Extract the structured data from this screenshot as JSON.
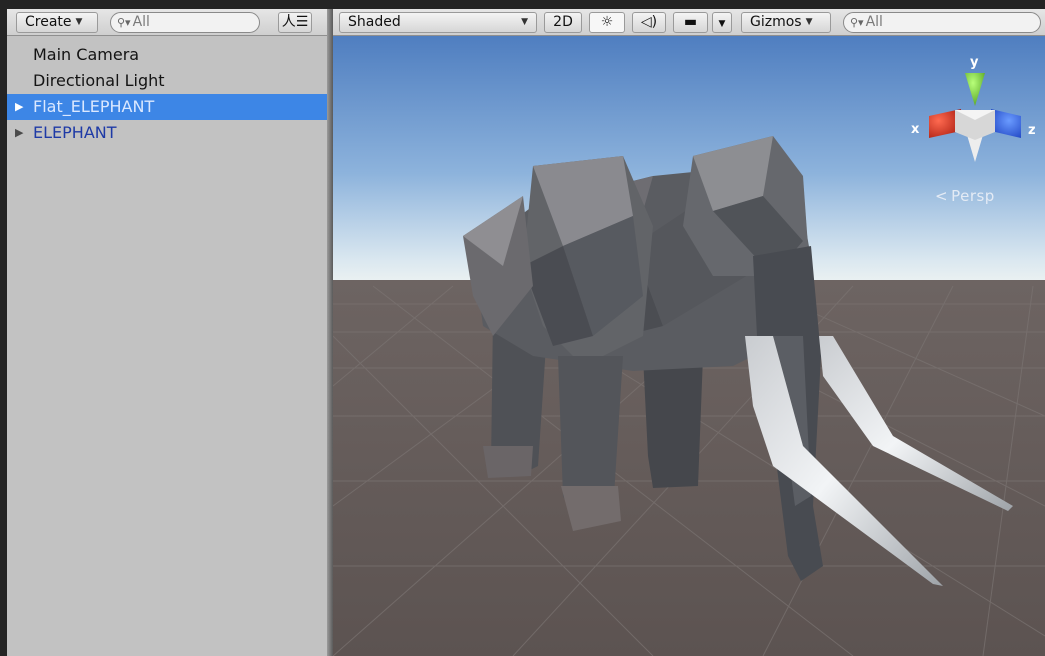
{
  "hierarchy": {
    "create_label": "Create",
    "search_text": "All",
    "items": [
      {
        "label": "Main Camera"
      },
      {
        "label": "Directional Light"
      },
      {
        "label": "Flat_ELEPHANT"
      },
      {
        "label": "ELEPHANT"
      }
    ]
  },
  "scene": {
    "shading_mode": "Shaded",
    "mode_2d_label": "2D",
    "gizmos_label": "Gizmos",
    "search_text": "All",
    "gizmo": {
      "x_label": "x",
      "y_label": "y",
      "z_label": "z",
      "projection_label": "Persp"
    }
  },
  "colors": {
    "selection": "#3d86e6",
    "prefab_text": "#1e3aa6",
    "axis_x": "#d2321e",
    "axis_y": "#7dd23a",
    "axis_z": "#2a5fe0"
  }
}
